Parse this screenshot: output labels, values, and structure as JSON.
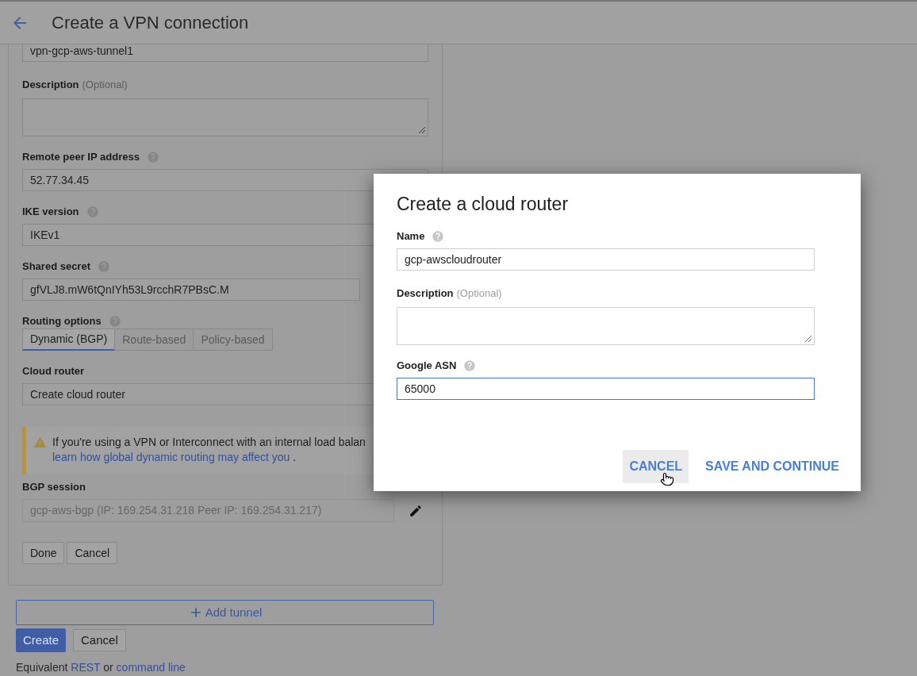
{
  "header": {
    "title": "Create a VPN connection"
  },
  "tunnel_form": {
    "fields": [
      {
        "kind": "input",
        "help": false,
        "value": "vpn-gcp-aws-tunnel1"
      },
      {
        "kind": "textarea",
        "label": "Description",
        "note": "(Optional)",
        "help": false
      },
      {
        "kind": "input",
        "label": "Remote peer IP address",
        "help": true,
        "value": "52.77.34.45"
      },
      {
        "kind": "input",
        "label": "IKE version",
        "help": true,
        "value": "IKEv1"
      },
      {
        "kind": "secret",
        "label": "Shared secret",
        "help": true,
        "value": "gfVLJ8.mW6tQnIYh53L9rcchR7PBsC.M"
      },
      {
        "kind": "segmented",
        "label": "Routing options",
        "help": true,
        "options": [
          {
            "label": "Dynamic (BGP)",
            "selected": true
          },
          {
            "label": "Route-based",
            "selected": false
          },
          {
            "label": "Policy-based",
            "selected": false
          }
        ]
      },
      {
        "kind": "select",
        "label": "Cloud router",
        "help": false,
        "value": "Create cloud router"
      },
      {
        "kind": "warning",
        "text": "If you're using a VPN or Interconnect with an internal load balan",
        "link": "learn how global dynamic routing may affect you",
        "suffix": "."
      },
      {
        "kind": "readonly",
        "label": "BGP session",
        "help": false,
        "value": "gcp-aws-bgp (IP: 169.254.31.218 Peer IP: 169.254.31.217)",
        "disabled": true
      }
    ],
    "actions": [
      "Done",
      "Cancel"
    ]
  },
  "add_tunnel": {
    "label": "Add tunnel"
  },
  "form_actions": [
    {
      "label": "Create",
      "kind": "primary"
    },
    {
      "label": "Cancel",
      "kind": "secondary"
    }
  ],
  "footer": {
    "parts": [
      {
        "kind": "text",
        "text": "Equivalent"
      },
      {
        "kind": "link",
        "text": "REST"
      },
      {
        "kind": "text",
        "text": "or"
      },
      {
        "kind": "link",
        "text": "command line"
      }
    ]
  },
  "dialog": {
    "title": "Create a cloud router",
    "fields": [
      {
        "kind": "input",
        "label": "Name",
        "help": true,
        "value": "gcp-awscloudrouter",
        "focused": false
      },
      {
        "kind": "textarea",
        "label": "Description",
        "note": "(Optional)",
        "help": false
      },
      {
        "kind": "input",
        "label": "Google ASN",
        "help": true,
        "value": "65000",
        "focused": true
      }
    ],
    "buttons": [
      {
        "label": "CANCEL",
        "hovered": true
      },
      {
        "label": "SAVE AND CONTINUE",
        "hovered": false
      }
    ]
  }
}
